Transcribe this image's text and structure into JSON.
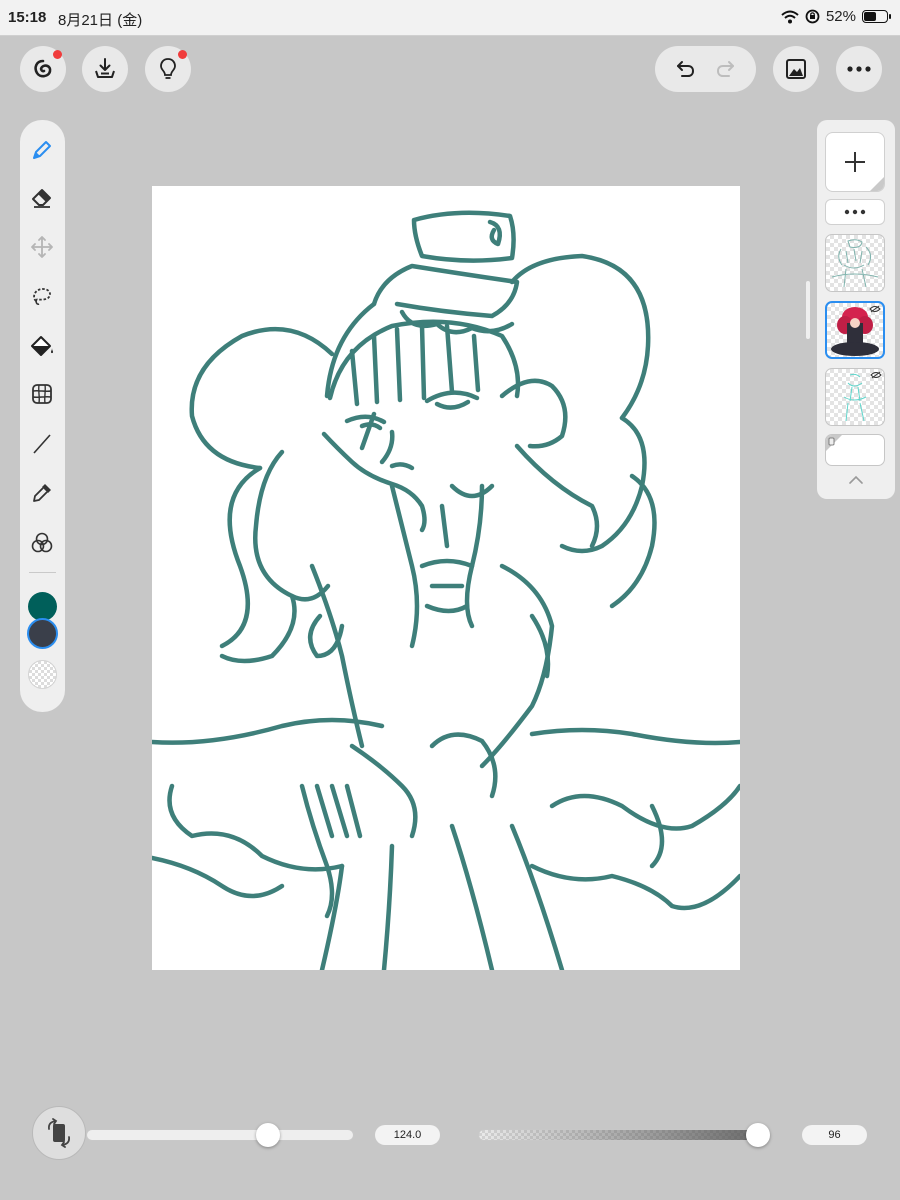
{
  "status_bar": {
    "time": "15:18",
    "date": "8月21日 (金)",
    "battery": "52%"
  },
  "top_toolbar": {
    "left_buttons": [
      "gallery-swirl",
      "save-import",
      "hint-bulb"
    ],
    "right_buttons": [
      "undo",
      "redo",
      "canvas-image",
      "more-menu"
    ],
    "notification_color": "#f03c3c"
  },
  "tools": [
    "pen",
    "eraser",
    "move",
    "lasso",
    "fill",
    "grid-transform",
    "line",
    "eyedropper",
    "blend"
  ],
  "active_tool": "pen",
  "colors": {
    "primary": "#005f5a",
    "secondary": "#3a3f4a",
    "accent": "#2b8ef0",
    "stroke": "#3e7f7a"
  },
  "layers": {
    "count": 4,
    "selected_index": 1
  },
  "brush": {
    "size": "124.0",
    "size_fraction": 0.68,
    "opacity": "96",
    "opacity_fraction": 0.96
  }
}
